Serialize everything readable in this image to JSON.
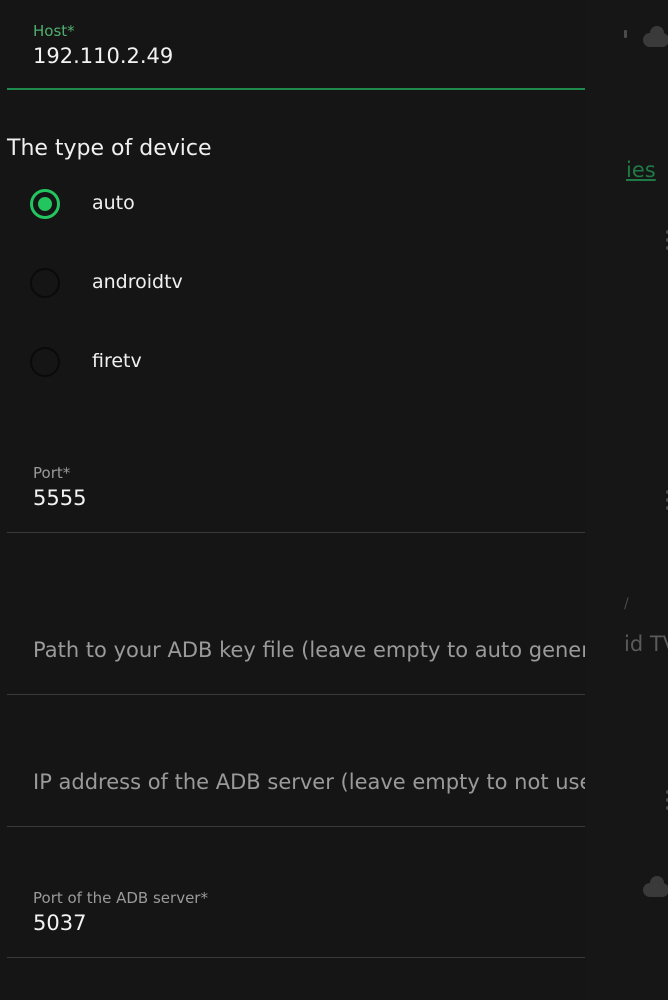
{
  "dialog": {
    "host": {
      "label": "Host*",
      "value": "192.110.2.49"
    },
    "device_type": {
      "title": "The type of device",
      "selected": "auto",
      "options": [
        {
          "label": "auto"
        },
        {
          "label": "androidtv"
        },
        {
          "label": "firetv"
        }
      ]
    },
    "port": {
      "label": "Port*",
      "value": "5555"
    },
    "adb_key": {
      "placeholder": "Path to your ADB key file (leave empty to auto generate)",
      "value": ""
    },
    "adb_server_ip": {
      "placeholder": "IP address of the ADB server (leave empty to not use)",
      "value": ""
    },
    "adb_server_port": {
      "label": "Port of the ADB server*",
      "value": "5037"
    }
  },
  "background": {
    "link_fragment": "ies",
    "text_fragment": "id TV",
    "mark_fragment": "/"
  },
  "colors": {
    "accent": "#22c55e",
    "focused_label": "#4fae6e",
    "background": "#151515"
  }
}
